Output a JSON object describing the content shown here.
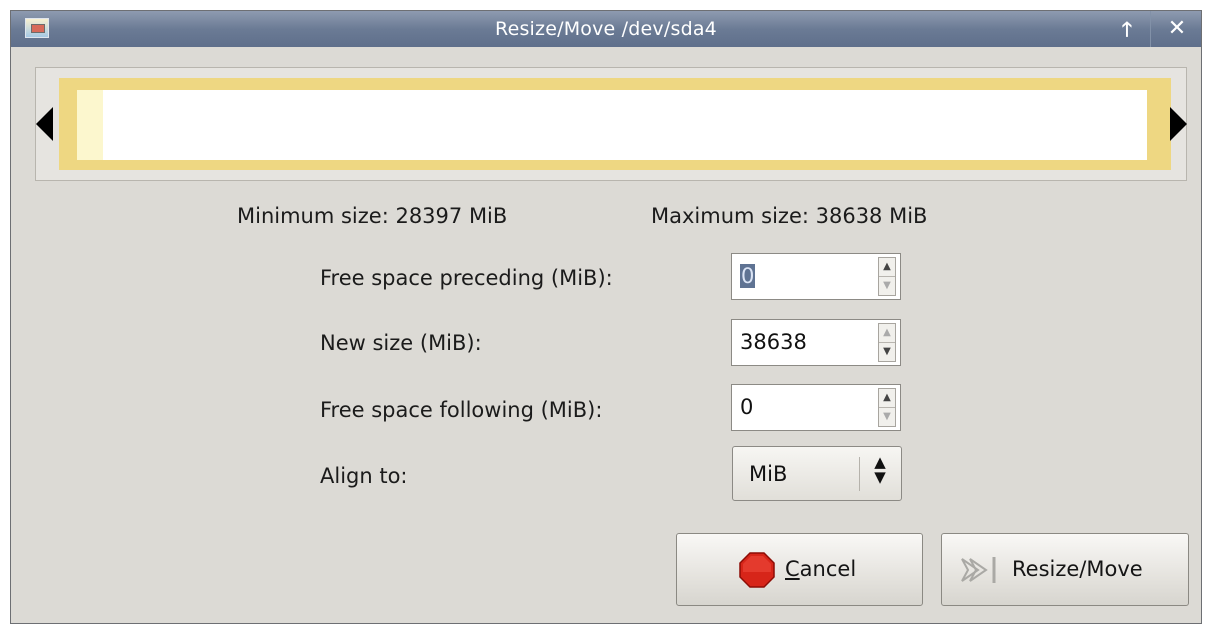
{
  "window": {
    "title": "Resize/Move /dev/sda4"
  },
  "titlebar": {
    "app_icon": "app-window-icon",
    "up_icon": "up-arrow-icon",
    "close_icon": "close-icon",
    "up_glyph": "🡑",
    "close_glyph": "✕"
  },
  "limits": {
    "minimum": "Minimum size: 28397 MiB",
    "maximum": "Maximum size: 38638 MiB"
  },
  "form": {
    "free_preceding_label": "Free space preceding (MiB):",
    "free_preceding_value": "0",
    "new_size_label": "New size (MiB):",
    "new_size_value": "38638",
    "free_following_label": "Free space following (MiB):",
    "free_following_value": "0",
    "align_label": "Align to:",
    "align_value": "MiB"
  },
  "buttons": {
    "cancel_prefix": "",
    "cancel_mnemonic": "C",
    "cancel_rest": "ancel",
    "resize_move": "Resize/Move"
  },
  "colors": {
    "partition_border": "#eed782",
    "used_space": "#fcf7ce",
    "unused_space": "#ffffff",
    "titlebar": "#6b7b95"
  }
}
